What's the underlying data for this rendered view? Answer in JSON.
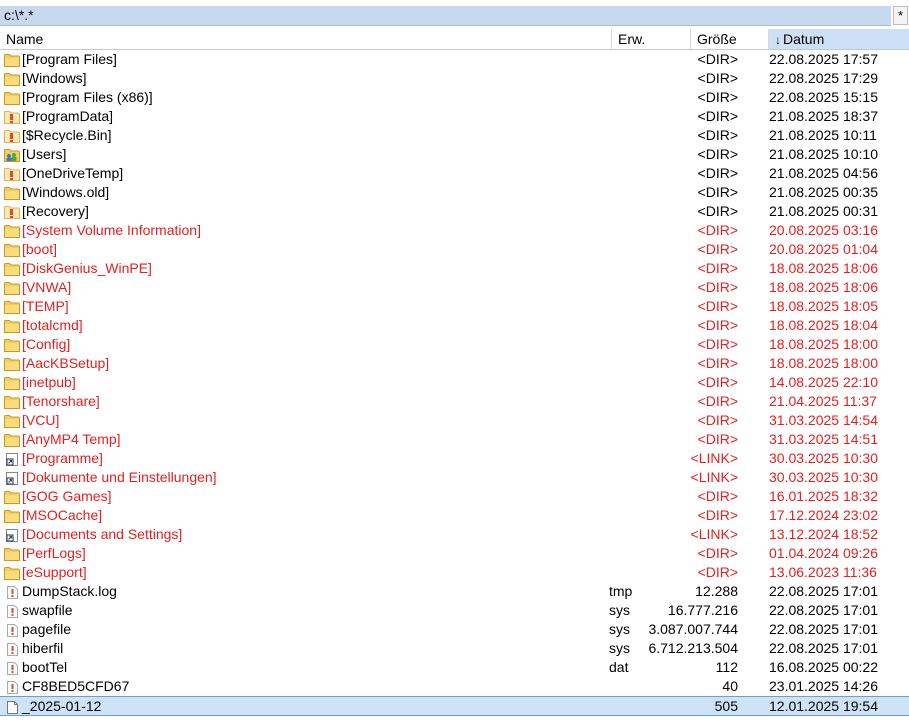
{
  "pathbar": {
    "path": "c:\\*.*",
    "filter_symbol": "*"
  },
  "header": {
    "name": "Name",
    "ext": "Erw.",
    "size": "Größe",
    "date": "Datum",
    "sort_arrow": "↓"
  },
  "colors": {
    "system_hidden": "#e51f1f",
    "selection": "#cfe3f7",
    "sorted_column": "#cce1f5",
    "folder": "#f2c94c"
  },
  "files": [
    {
      "name": "[Program Files]",
      "ext": "",
      "size": "<DIR>",
      "date": "22.08.2025 17:57",
      "icon": "folder-icon",
      "red": false
    },
    {
      "name": "[Windows]",
      "ext": "",
      "size": "<DIR>",
      "date": "22.08.2025 17:29",
      "icon": "folder-icon",
      "red": false
    },
    {
      "name": "[Program Files (x86)]",
      "ext": "",
      "size": "<DIR>",
      "date": "22.08.2025 15:15",
      "icon": "folder-icon",
      "red": false
    },
    {
      "name": "[ProgramData]",
      "ext": "",
      "size": "<DIR>",
      "date": "21.08.2025 18:37",
      "icon": "hidden-folder-icon",
      "red": false
    },
    {
      "name": "[$Recycle.Bin]",
      "ext": "",
      "size": "<DIR>",
      "date": "21.08.2025 10:11",
      "icon": "hidden-folder-icon",
      "red": false
    },
    {
      "name": "[Users]",
      "ext": "",
      "size": "<DIR>",
      "date": "21.08.2025 10:10",
      "icon": "users-folder-icon",
      "red": false
    },
    {
      "name": "[OneDriveTemp]",
      "ext": "",
      "size": "<DIR>",
      "date": "21.08.2025 04:56",
      "icon": "hidden-folder-icon",
      "red": false
    },
    {
      "name": "[Windows.old]",
      "ext": "",
      "size": "<DIR>",
      "date": "21.08.2025 00:35",
      "icon": "folder-icon",
      "red": false
    },
    {
      "name": "[Recovery]",
      "ext": "",
      "size": "<DIR>",
      "date": "21.08.2025 00:31",
      "icon": "hidden-folder-icon",
      "red": false
    },
    {
      "name": "[System Volume Information]",
      "ext": "",
      "size": "<DIR>",
      "date": "20.08.2025 03:16",
      "icon": "folder-icon",
      "red": true
    },
    {
      "name": "[boot]",
      "ext": "",
      "size": "<DIR>",
      "date": "20.08.2025 01:04",
      "icon": "folder-icon",
      "red": true
    },
    {
      "name": "[DiskGenius_WinPE]",
      "ext": "",
      "size": "<DIR>",
      "date": "18.08.2025 18:06",
      "icon": "folder-icon",
      "red": true
    },
    {
      "name": "[VNWA]",
      "ext": "",
      "size": "<DIR>",
      "date": "18.08.2025 18:06",
      "icon": "folder-icon",
      "red": true
    },
    {
      "name": "[TEMP]",
      "ext": "",
      "size": "<DIR>",
      "date": "18.08.2025 18:05",
      "icon": "folder-icon",
      "red": true
    },
    {
      "name": "[totalcmd]",
      "ext": "",
      "size": "<DIR>",
      "date": "18.08.2025 18:04",
      "icon": "folder-icon",
      "red": true
    },
    {
      "name": "[Config]",
      "ext": "",
      "size": "<DIR>",
      "date": "18.08.2025 18:00",
      "icon": "folder-icon",
      "red": true
    },
    {
      "name": "[AacKBSetup]",
      "ext": "",
      "size": "<DIR>",
      "date": "18.08.2025 18:00",
      "icon": "folder-icon",
      "red": true
    },
    {
      "name": "[inetpub]",
      "ext": "",
      "size": "<DIR>",
      "date": "14.08.2025 22:10",
      "icon": "folder-icon",
      "red": true
    },
    {
      "name": "[Tenorshare]",
      "ext": "",
      "size": "<DIR>",
      "date": "21.04.2025 11:37",
      "icon": "folder-icon",
      "red": true
    },
    {
      "name": "[VCU]",
      "ext": "",
      "size": "<DIR>",
      "date": "31.03.2025 14:54",
      "icon": "folder-icon",
      "red": true
    },
    {
      "name": "[AnyMP4 Temp]",
      "ext": "",
      "size": "<DIR>",
      "date": "31.03.2025 14:51",
      "icon": "folder-icon",
      "red": true
    },
    {
      "name": "[Programme]",
      "ext": "",
      "size": "<LINK>",
      "date": "30.03.2025 10:30",
      "icon": "link-icon",
      "red": true
    },
    {
      "name": "[Dokumente und Einstellungen]",
      "ext": "",
      "size": "<LINK>",
      "date": "30.03.2025 10:30",
      "icon": "link-icon",
      "red": true
    },
    {
      "name": "[GOG Games]",
      "ext": "",
      "size": "<DIR>",
      "date": "16.01.2025 18:32",
      "icon": "folder-icon",
      "red": true
    },
    {
      "name": "[MSOCache]",
      "ext": "",
      "size": "<DIR>",
      "date": "17.12.2024 23:02",
      "icon": "folder-icon",
      "red": true
    },
    {
      "name": "[Documents and Settings]",
      "ext": "",
      "size": "<LINK>",
      "date": "13.12.2024 18:52",
      "icon": "link-icon",
      "red": true
    },
    {
      "name": "[PerfLogs]",
      "ext": "",
      "size": "<DIR>",
      "date": "01.04.2024 09:26",
      "icon": "folder-icon",
      "red": true
    },
    {
      "name": "[eSupport]",
      "ext": "",
      "size": "<DIR>",
      "date": "13.06.2023 11:36",
      "icon": "folder-icon",
      "red": true
    },
    {
      "name": "DumpStack.log",
      "ext": "tmp",
      "size": "12.288",
      "date": "22.08.2025 17:01",
      "icon": "hidden-file-icon",
      "red": false
    },
    {
      "name": "swapfile",
      "ext": "sys",
      "size": "16.777.216",
      "date": "22.08.2025 17:01",
      "icon": "hidden-file-icon",
      "red": false
    },
    {
      "name": "pagefile",
      "ext": "sys",
      "size": "3.087.007.744",
      "date": "22.08.2025 17:01",
      "icon": "hidden-file-icon",
      "red": false
    },
    {
      "name": "hiberfil",
      "ext": "sys",
      "size": "6.712.213.504",
      "date": "22.08.2025 17:01",
      "icon": "hidden-file-icon",
      "red": false
    },
    {
      "name": "bootTel",
      "ext": "dat",
      "size": "112",
      "date": "16.08.2025 00:22",
      "icon": "hidden-file-icon",
      "red": false
    },
    {
      "name": "CF8BED5CFD67",
      "ext": "",
      "size": "40",
      "date": "23.01.2025 14:26",
      "icon": "hidden-file-icon",
      "red": false
    },
    {
      "name": "_2025-01-12",
      "ext": "",
      "size": "505",
      "date": "12.01.2025 19:54",
      "icon": "file-icon",
      "red": false,
      "selected": true
    }
  ]
}
